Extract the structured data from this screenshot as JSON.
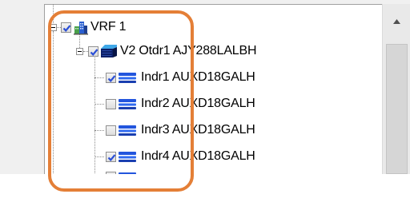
{
  "tree": {
    "root": {
      "label": "VRF 1",
      "checked": true,
      "icon": "building-icon"
    },
    "outdoor": {
      "label": "V2 Otdr1 AJY288LALBH",
      "checked": true,
      "icon": "outdoor-unit-icon"
    },
    "indoor_units": [
      {
        "label": "Indr1 AUXD18GALH",
        "checked": true,
        "icon": "indoor-unit-icon"
      },
      {
        "label": "Indr2 AUXD18GALH",
        "checked": false,
        "icon": "indoor-unit-icon"
      },
      {
        "label": "Indr3 AUXD18GALH",
        "checked": false,
        "icon": "indoor-unit-icon"
      },
      {
        "label": "Indr4 AUXD18GALH",
        "checked": true,
        "icon": "indoor-unit-icon"
      }
    ]
  },
  "scrollbar": {
    "up_icon": "triangle-up-icon"
  },
  "colors": {
    "highlight": "#e47f37",
    "checkmark": "#2b4fd6",
    "unit_blue": "#2255dd"
  }
}
